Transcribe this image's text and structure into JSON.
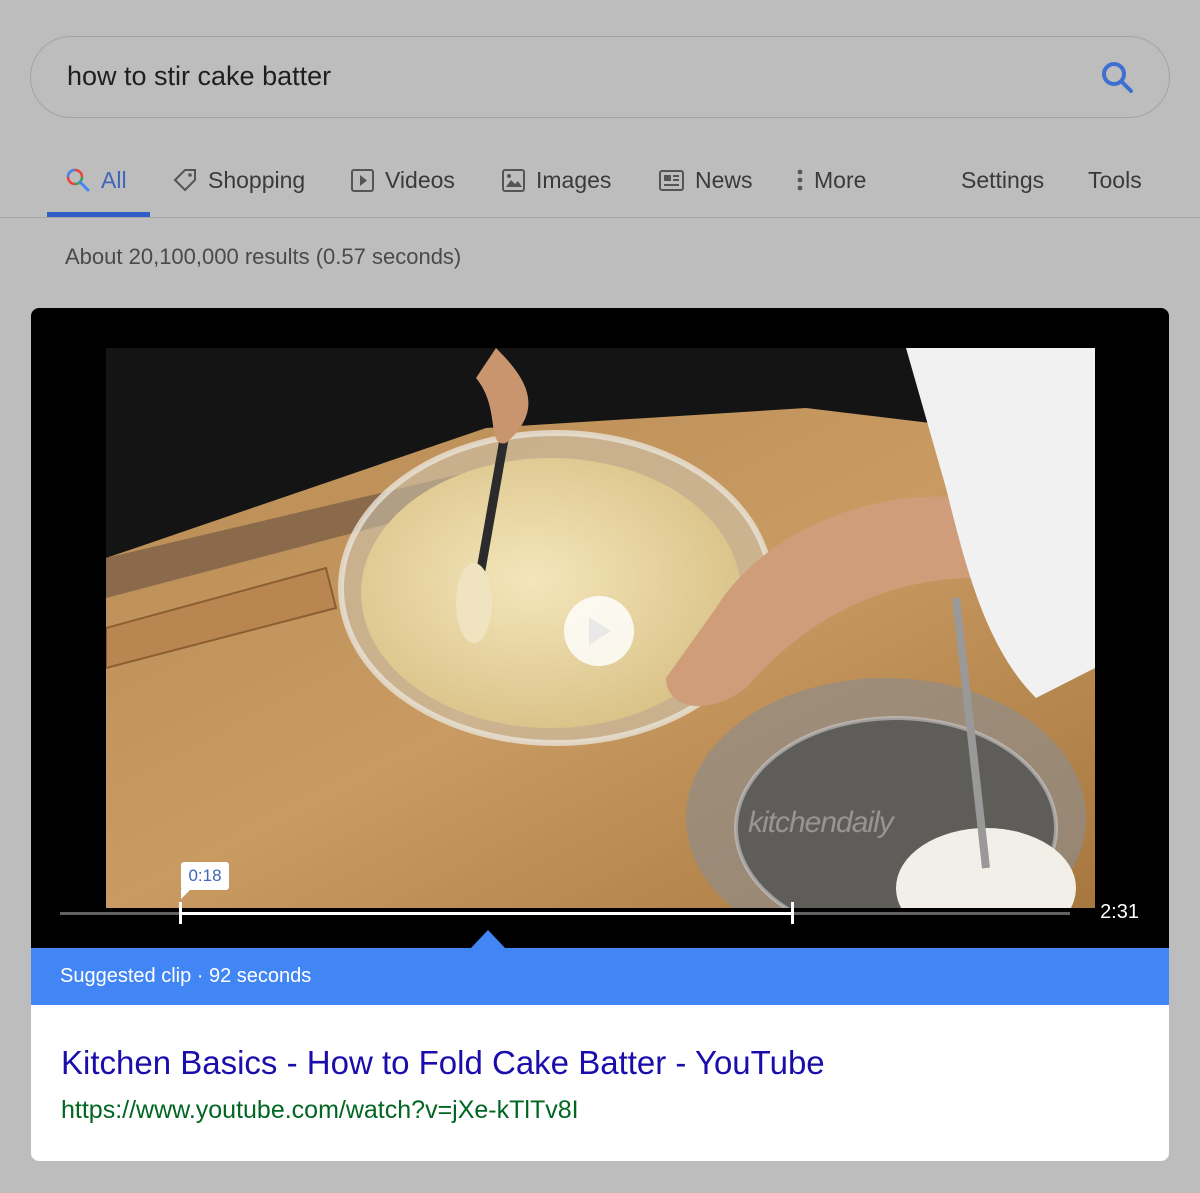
{
  "search": {
    "query": "how to stir cake batter"
  },
  "tabs": [
    {
      "label": "All",
      "icon": "search-icon",
      "active": true
    },
    {
      "label": "Shopping",
      "icon": "tag-icon"
    },
    {
      "label": "Videos",
      "icon": "play-box-icon"
    },
    {
      "label": "Images",
      "icon": "image-icon"
    },
    {
      "label": "News",
      "icon": "newspaper-icon"
    },
    {
      "label": "More",
      "icon": "vertical-dots-icon"
    },
    {
      "label": "Settings"
    },
    {
      "label": "Tools"
    }
  ],
  "results_stats": "About 20,100,000 results (0.57 seconds)",
  "video": {
    "watermark": "kitchendaily",
    "clip_start": "0:18",
    "duration": "2:31",
    "suggested_clip": "Suggested clip · 92 seconds"
  },
  "result": {
    "title": "Kitchen Basics - How to Fold Cake Batter - YouTube",
    "url": "https://www.youtube.com/watch?v=jXe-kTlTv8I"
  },
  "colors": {
    "link": "#1a0dab",
    "url": "#006621",
    "accent": "#4285f4",
    "tab_active": "#3f66b8"
  }
}
